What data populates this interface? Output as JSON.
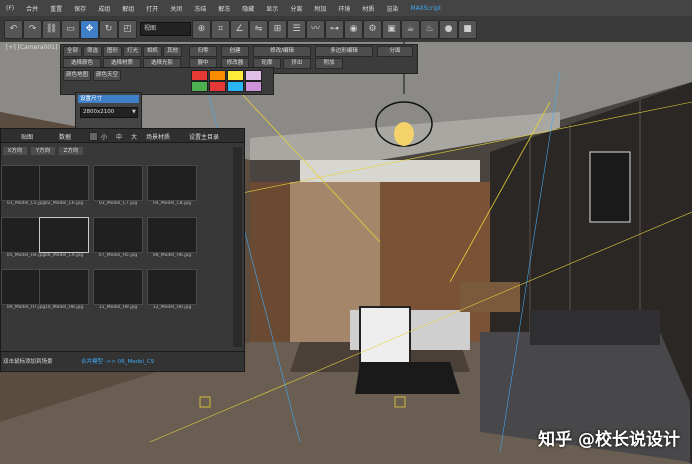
{
  "viewport_label": "[+] [Camera001] [",
  "toolbar": {
    "view_select": "视图"
  },
  "panel": {
    "row1": [
      "全部",
      "筛选",
      "图形",
      "灯光",
      "相机",
      "其他",
      "归零",
      "创建",
      "修改/编辑",
      "多边形编辑",
      "分面"
    ],
    "row2": [
      "选择颜色",
      "选择材质",
      "选择光影",
      "展中",
      "修改器",
      "轮廓",
      "挤出",
      "附加"
    ],
    "row3": [
      "颜色地图",
      "颜色天空"
    ]
  },
  "swatches": [
    "#e53935",
    "#fb8c00",
    "#ffeb3b",
    "#e1bee7",
    "#4caf50",
    "#e53935",
    "#29b6f6",
    "#ce93d8"
  ],
  "popup": {
    "title": "设置尺寸",
    "value": "2800x2100"
  },
  "browser": {
    "tab_main": "贴图",
    "tab_data": "数据",
    "sizes": [
      "小",
      "中",
      "大"
    ],
    "option1": "场景材质",
    "option2": "设置主目录",
    "filters": [
      "X方向",
      "Y方向",
      "Z方向"
    ],
    "thumbnails": [
      [
        "01_Model_C5.jpg",
        "02_Model_C6.jpg",
        "03_Model_C7.jpg",
        "04_Model_C8.jpg"
      ],
      [
        "05_Model_H4.jpg",
        "06_Model_C9.jpg",
        "07_Model_H5.jpg",
        "08_Model_H6.jpg"
      ],
      [
        "09_Model_H7.jpg",
        "10_Model_H8.jpg",
        "11_Model_H9.jpg",
        "12_Model_H0.jpg"
      ]
    ],
    "status_left": "双击鼠标添加到场景",
    "status_right": "合并模型 ->> 06_Model_C9"
  },
  "watermark": "知乎 @校长说设计"
}
